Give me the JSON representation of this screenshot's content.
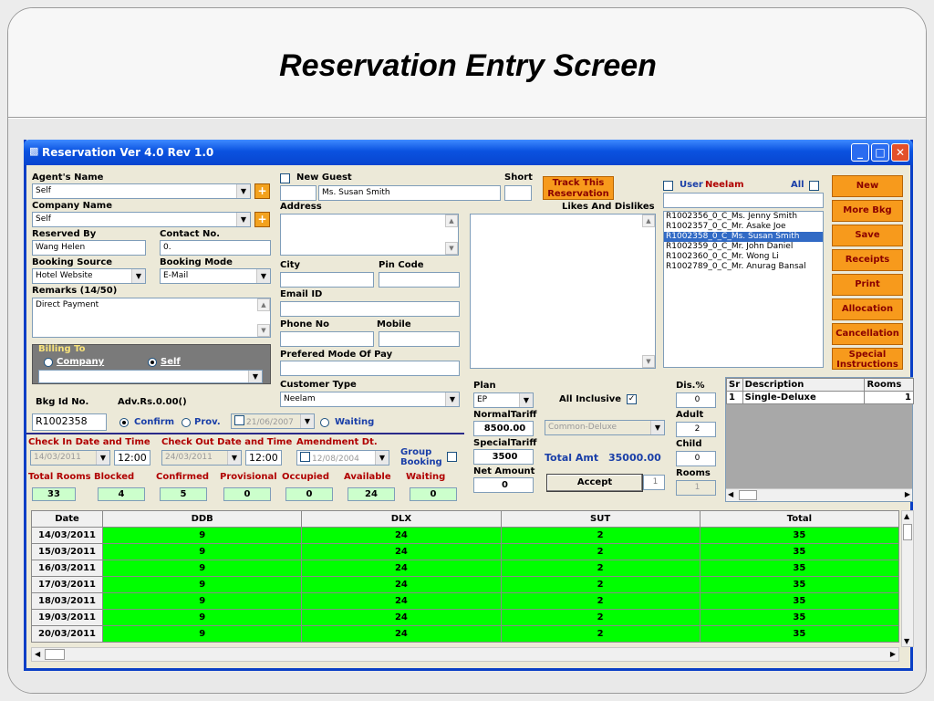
{
  "slide": {
    "title": "Reservation Entry Screen"
  },
  "window": {
    "title": "Reservation Ver 4.0 Rev 1.0"
  },
  "left": {
    "agents_name_label": "Agent's Name",
    "agents_name_value": "Self",
    "company_name_label": "Company Name",
    "company_name_value": "Self",
    "reserved_by_label": "Reserved By",
    "reserved_by_value": "Wang Helen",
    "contact_no_label": "Contact No.",
    "contact_no_value": "0.",
    "booking_source_label": "Booking Source",
    "booking_source_value": "Hotel Website",
    "booking_mode_label": "Booking Mode",
    "booking_mode_value": "E-Mail",
    "remarks_label": "Remarks (14/50)",
    "remarks_value": "Direct Payment",
    "billing_to_label": "Billing To",
    "billing_company": "Company",
    "billing_self": "Self",
    "bkg_id_label": "Bkg Id No.",
    "adv_label": "Adv.Rs.0.00()",
    "bkg_id_value": "R1002358",
    "confirm": "Confirm",
    "prov": "Prov.",
    "prov_date": "21/06/2007",
    "waiting": "Waiting"
  },
  "middle": {
    "new_guest_label": "New Guest",
    "short_label": "Short",
    "guest_name": "Ms. Susan Smith",
    "track_button": "Track This Reservation",
    "address_label": "Address",
    "likes_label": "Likes And Dislikes",
    "city_label": "City",
    "pin_label": "Pin Code",
    "email_label": "Email ID",
    "phone_label": "Phone No",
    "mobile_label": "Mobile",
    "mode_pay_label": "Prefered Mode Of Pay",
    "customer_type_label": "Customer Type",
    "customer_type_value": "Neelam"
  },
  "list": {
    "user_label": "User",
    "user_name": "Neelam",
    "all_label": "All",
    "items": [
      "R1002356_0_C_Ms. Jenny Smith",
      "R1002357_0_C_Mr. Asake Joe",
      "R1002358_0_C_Ms. Susan Smith",
      "R1002359_0_C_Mr. John Daniel",
      "R1002360_0_C_Mr. Wong Li",
      "R1002789_0_C_Mr. Anurag Bansal"
    ],
    "selected_index": 2
  },
  "buttons": [
    "New",
    "More Bkg",
    "Save",
    "Receipts",
    "Print",
    "Allocation",
    "Cancellation",
    "Special Instructions"
  ],
  "plan": {
    "plan_label": "Plan",
    "plan_value": "EP",
    "all_inclusive_label": "All Inclusive",
    "dis_label": "Dis.%",
    "dis_value": "0",
    "normal_label": "NormalTariff",
    "normal_value": "8500.00",
    "room_type": "Common-Deluxe",
    "adult_label": "Adult",
    "adult_value": "2",
    "special_label": "SpecialTariff",
    "special_value": "3500",
    "total_label": "Total Amt",
    "total_value": "35000.00",
    "child_label": "Child",
    "child_value": "0",
    "net_label": "Net Amount",
    "net_value": "0",
    "accept_button": "Accept",
    "accept_count": "1",
    "rooms_label": "Rooms",
    "rooms_value": "1"
  },
  "room_table": {
    "headers": [
      "Sr",
      "Description",
      "Rooms"
    ],
    "rows": [
      [
        "1",
        "Single-Deluxe",
        "1"
      ]
    ]
  },
  "dates": {
    "checkin_label": "Check In Date and Time",
    "checkin_date": "14/03/2011",
    "checkin_time": "12:00",
    "checkout_label": "Check Out Date and Time",
    "checkout_date": "24/03/2011",
    "checkout_time": "12:00",
    "amend_label": "Amendment Dt.",
    "amend_date": "12/08/2004",
    "group_label": "Group Booking"
  },
  "status": {
    "labels": [
      "Total Rooms",
      "Blocked",
      "Confirmed",
      "Provisional",
      "Occupied",
      "Available",
      "Waiting"
    ],
    "values": [
      "33",
      "4",
      "5",
      "0",
      "0",
      "24",
      "0"
    ]
  },
  "grid": {
    "headers": [
      "Date",
      "DDB",
      "DLX",
      "SUT",
      "Total"
    ],
    "rows": [
      [
        "14/03/2011",
        "9",
        "24",
        "2",
        "35"
      ],
      [
        "15/03/2011",
        "9",
        "24",
        "2",
        "35"
      ],
      [
        "16/03/2011",
        "9",
        "24",
        "2",
        "35"
      ],
      [
        "17/03/2011",
        "9",
        "24",
        "2",
        "35"
      ],
      [
        "18/03/2011",
        "9",
        "24",
        "2",
        "35"
      ],
      [
        "19/03/2011",
        "9",
        "24",
        "2",
        "35"
      ],
      [
        "20/03/2011",
        "9",
        "24",
        "2",
        "35"
      ]
    ]
  }
}
